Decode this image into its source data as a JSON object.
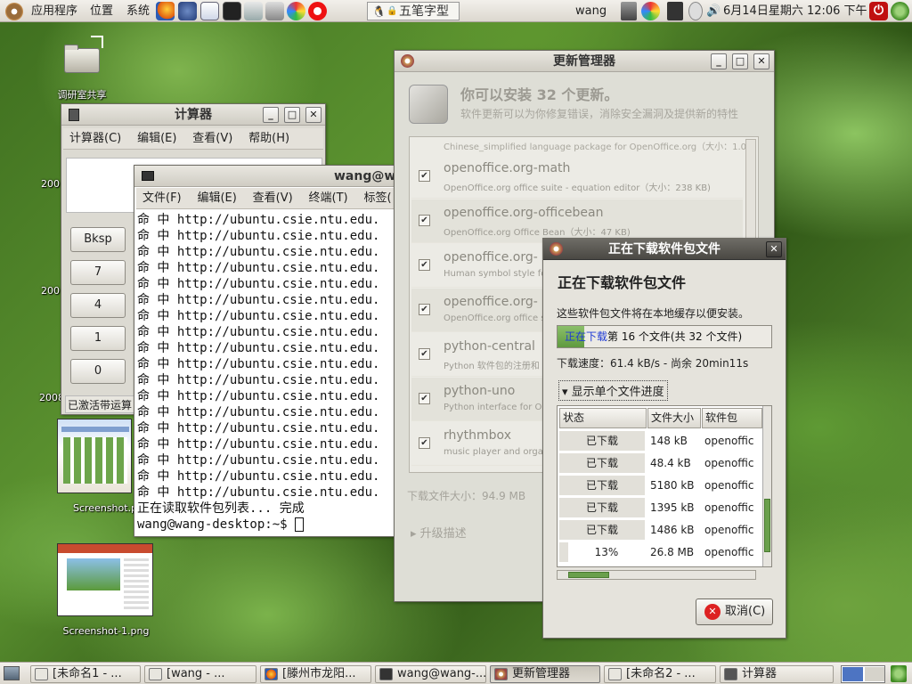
{
  "top_panel": {
    "menus": [
      "应用程序",
      "位置",
      "系统"
    ],
    "input_method": "五笔字型",
    "user": "wang",
    "clock": "6月14日星期六 12:06 下午"
  },
  "desktop": {
    "icons": [
      {
        "label": "调研室共享",
        "icon": "folder-icon"
      },
      {
        "label": "Screenshot.p",
        "icon": "image-icon"
      },
      {
        "label": "Screenshot-1.png",
        "icon": "image-icon"
      }
    ],
    "partial_labels": [
      "200",
      "200",
      "2008"
    ]
  },
  "calculator": {
    "title": "计算器",
    "menu": [
      "计算器(C)",
      "编辑(E)",
      "查看(V)",
      "帮助(H)"
    ],
    "buttons": [
      "Bksp",
      "7",
      "4",
      "1",
      "0"
    ],
    "status": "已激活带运算"
  },
  "terminal": {
    "title": "wang@w",
    "menu": [
      "文件(F)",
      "编辑(E)",
      "查看(V)",
      "终端(T)",
      "标签("
    ],
    "lines": [
      "命 中 http://ubuntu.csie.ntu.edu.",
      "命 中 http://ubuntu.csie.ntu.edu.",
      "命 中 http://ubuntu.csie.ntu.edu.",
      "命 中 http://ubuntu.csie.ntu.edu.",
      "命 中 http://ubuntu.csie.ntu.edu.",
      "命 中 http://ubuntu.csie.ntu.edu.",
      "命 中 http://ubuntu.csie.ntu.edu.",
      "命 中 http://ubuntu.csie.ntu.edu.",
      "命 中 http://ubuntu.csie.ntu.edu.",
      "命 中 http://ubuntu.csie.ntu.edu.",
      "命 中 http://ubuntu.csie.ntu.edu.",
      "命 中 http://ubuntu.csie.ntu.edu.",
      "命 中 http://ubuntu.csie.ntu.edu.",
      "命 中 http://ubuntu.csie.ntu.edu.",
      "命 中 http://ubuntu.csie.ntu.edu.",
      "命 中 http://ubuntu.csie.ntu.edu.",
      "命 中 http://ubuntu.csie.ntu.edu.",
      "命 中 http://ubuntu.csie.ntu.edu.",
      "正在读取软件包列表... 完成"
    ],
    "prompt": "wang@wang-desktop:~$"
  },
  "update_manager": {
    "title": "更新管理器",
    "headline": "你可以安装 32 个更新。",
    "subtitle": "软件更新可以为你修复错误，消除安全漏洞及提供新的特性",
    "partial_top": "Chinese_simplified language package for OpenOffice.org（大小：1.0",
    "packages": [
      {
        "name": "openoffice.org-math",
        "desc": "OpenOffice.org office suite - equation editor（大小：238 KB)"
      },
      {
        "name": "openoffice.org-officebean",
        "desc": "OpenOffice.org Office Bean（大小：47 KB)"
      },
      {
        "name": "openoffice.org-",
        "desc": "Human symbol style fo"
      },
      {
        "name": "openoffice.org-",
        "desc": "OpenOffice.org office su"
      },
      {
        "name": "python-central",
        "desc": "Python 软件包的注册和"
      },
      {
        "name": "python-uno",
        "desc": "Python interface for Op"
      },
      {
        "name": "rhythmbox",
        "desc": "music player and orgar"
      }
    ],
    "download_size": "下载文件大小：94.9 MB",
    "details_label": "升级描述"
  },
  "download_dialog": {
    "title": "正在下载软件包文件",
    "heading": "正在下载软件包文件",
    "description": "这些软件包文件将在本地缓存以便安装。",
    "progress_text_highlight": "正在下载",
    "progress_text_rest": "第 16 个文件(共 32 个文件)",
    "progress_fraction": 0.5,
    "speed": "下载速度：61.4 kB/s - 尚余 20min11s",
    "expander_label": "显示单个文件进度",
    "columns": [
      "状态",
      "文件大小",
      "软件包"
    ],
    "rows": [
      {
        "status": "已下载",
        "size": "148 kB",
        "pkg": "openoffic"
      },
      {
        "status": "已下载",
        "size": "48.4 kB",
        "pkg": "openoffic"
      },
      {
        "status": "已下载",
        "size": "5180 kB",
        "pkg": "openoffic"
      },
      {
        "status": "已下载",
        "size": "1395 kB",
        "pkg": "openoffic"
      },
      {
        "status": "已下载",
        "size": "1486 kB",
        "pkg": "openoffic"
      },
      {
        "status": "13%",
        "size": "26.8 MB",
        "pkg": "openoffic"
      }
    ],
    "cancel_label": "取消(C)"
  },
  "taskbar": {
    "tasks": [
      {
        "label": "[未命名1 - ...",
        "icon": "document-icon"
      },
      {
        "label": "[wang - ...",
        "icon": "document-icon"
      },
      {
        "label": "[滕州市龙阳...",
        "icon": "firefox-icon"
      },
      {
        "label": "wang@wang-...",
        "icon": "terminal-icon"
      },
      {
        "label": "更新管理器",
        "icon": "update-icon"
      },
      {
        "label": "[未命名2 - ...",
        "icon": "document-icon"
      },
      {
        "label": "计算器",
        "icon": "calculator-icon"
      }
    ]
  },
  "colors": {
    "accent_blue": "#1f3bd6",
    "progress_green": "#6aa04c"
  }
}
